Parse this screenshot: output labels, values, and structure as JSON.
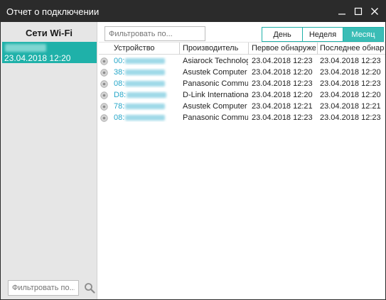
{
  "window": {
    "title": "Отчет о подключении"
  },
  "sidebar": {
    "heading": "Сети Wi-Fi",
    "networks": [
      {
        "date": "23.04.2018 12:20",
        "selected": true
      }
    ],
    "filter_placeholder": "Фильтровать по..."
  },
  "toolbar": {
    "filter_placeholder": "Фильтровать по...",
    "periods": [
      {
        "label": "День",
        "active": false
      },
      {
        "label": "Неделя",
        "active": false
      },
      {
        "label": "Месяц",
        "active": true
      }
    ]
  },
  "table": {
    "columns": [
      "Устройство",
      "Производитель",
      "Первое обнаружен...",
      "Последнее обнару..."
    ],
    "rows": [
      {
        "device": "00:",
        "manufacturer": "Asiarock Technology...",
        "first_seen": "23.04.2018 12:23",
        "last_seen": "23.04.2018 12:23"
      },
      {
        "device": "38:",
        "manufacturer": "Asustek Computer",
        "first_seen": "23.04.2018 12:20",
        "last_seen": "23.04.2018 12:20"
      },
      {
        "device": "08:",
        "manufacturer": "Panasonic Communi...",
        "first_seen": "23.04.2018 12:23",
        "last_seen": "23.04.2018 12:23"
      },
      {
        "device": "D8:",
        "manufacturer": "D-Link International",
        "first_seen": "23.04.2018 12:20",
        "last_seen": "23.04.2018 12:20"
      },
      {
        "device": "78:",
        "manufacturer": "Asustek Computer",
        "first_seen": "23.04.2018 12:21",
        "last_seen": "23.04.2018 12:21"
      },
      {
        "device": "08:",
        "manufacturer": "Panasonic Communi...",
        "first_seen": "23.04.2018 12:23",
        "last_seen": "23.04.2018 12:23"
      }
    ]
  },
  "colors": {
    "accent": "#1fb1a9",
    "mac_text": "#26a7c9",
    "titlebar": "#2b2b2b"
  }
}
